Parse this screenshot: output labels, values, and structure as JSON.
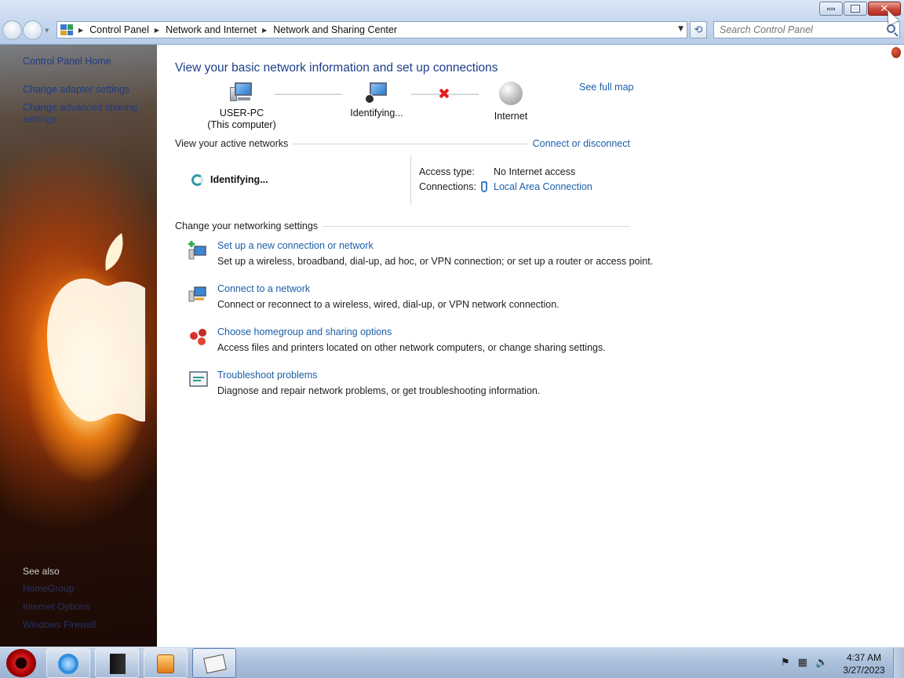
{
  "window": {
    "minimize_icon": "minimize-icon",
    "maximize_icon": "restore-icon",
    "close_icon": "close-icon"
  },
  "address_bar": {
    "breadcrumbs": [
      "Control Panel",
      "Network and Internet",
      "Network and Sharing Center"
    ],
    "search_placeholder": "Search Control Panel"
  },
  "sidebar": {
    "items": [
      {
        "label": "Control Panel Home"
      },
      {
        "label": "Change adapter settings"
      },
      {
        "label": "Change advanced sharing"
      },
      {
        "label": "settings"
      }
    ],
    "see_also_title": "See also",
    "see_also": [
      "HomeGroup",
      "Internet Options",
      "Windows Firewall"
    ]
  },
  "main": {
    "heading": "View your basic network information and set up connections",
    "see_full_map": "See full map",
    "map": {
      "computer_name": "USER-PC",
      "computer_sub": "(This computer)",
      "network_name": "Identifying...",
      "internet_label": "Internet"
    },
    "active_networks": {
      "title": "View your active networks",
      "connect_link": "Connect or disconnect",
      "network_status": "Identifying...",
      "access_type_label": "Access type:",
      "access_type_value": "No Internet access",
      "connections_label": "Connections:",
      "connections_value": "Local Area Connection"
    },
    "settings": {
      "title": "Change your networking settings",
      "tasks": [
        {
          "title": "Set up a new connection or network",
          "desc": "Set up a wireless, broadband, dial-up, ad hoc, or VPN connection; or set up a router or access point."
        },
        {
          "title": "Connect to a network",
          "desc": "Connect or reconnect to a wireless, wired, dial-up, or VPN network connection."
        },
        {
          "title": "Choose homegroup and sharing options",
          "desc": "Access files and printers located on other network computers, or change sharing settings."
        },
        {
          "title": "Troubleshoot problems",
          "desc": "Diagnose and repair network problems, or get troubleshooting information."
        }
      ]
    }
  },
  "taskbar": {
    "time": "4:37 AM",
    "date": "3/27/2023",
    "tray_icons": [
      "action-center-flag-icon",
      "network-icon",
      "volume-muted-icon"
    ]
  }
}
